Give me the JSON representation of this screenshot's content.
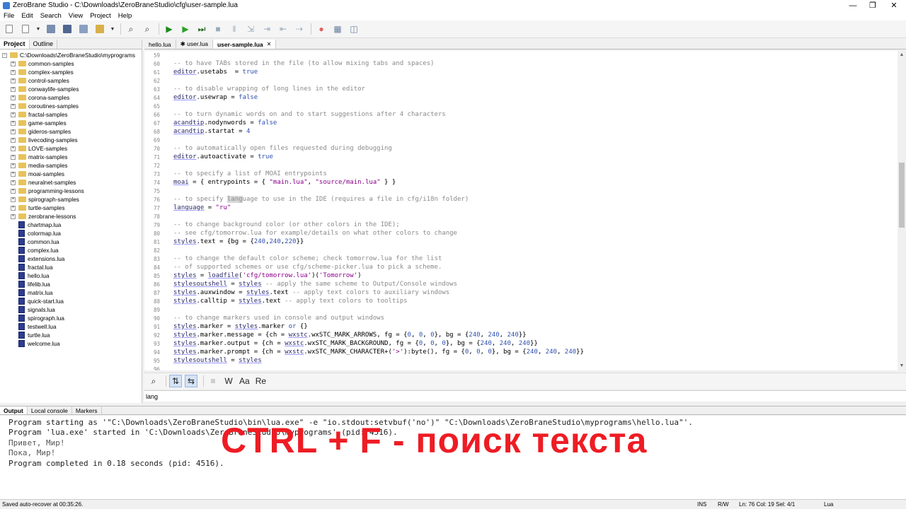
{
  "window": {
    "title": "ZeroBrane Studio - C:\\Downloads\\ZeroBraneStudio\\cfg\\user-sample.lua",
    "controls": [
      "—",
      "❐",
      "✕"
    ]
  },
  "menu": [
    "File",
    "Edit",
    "Search",
    "View",
    "Project",
    "Help"
  ],
  "toolbar": {
    "icons": [
      "new-file-icon",
      "open-file-icon",
      "dropdown-icon",
      "save-icon",
      "save-all-icon",
      "project-dir-icon",
      "project-dropdown-icon",
      "find-icon",
      "replace-icon",
      "start-debug-icon",
      "run-icon",
      "run-now-icon",
      "stop-icon",
      "break-icon",
      "step-into-icon",
      "step-over-icon",
      "step-out-icon",
      "run-to-cursor-icon",
      "toggle-breakpoint-icon",
      "stack-window-icon",
      "watch-window-icon"
    ]
  },
  "left_pane": {
    "tabs": [
      "Project",
      "Outline"
    ],
    "root": "C:\\Downloads\\ZeroBraneStudio\\myprograms",
    "folders": [
      "common-samples",
      "complex-samples",
      "control-samples",
      "conwaylife-samples",
      "corona-samples",
      "coroutines-samples",
      "fractal-samples",
      "game-samples",
      "gideros-samples",
      "livecoding-samples",
      "LOVE-samples",
      "matrix-samples",
      "media-samples",
      "moai-samples",
      "neuralnet-samples",
      "programming-lessons",
      "spirograph-samples",
      "turtle-samples",
      "zerobrane-lessons"
    ],
    "files": [
      "chartmap.lua",
      "colormap.lua",
      "common.lua",
      "complex.lua",
      "extensions.lua",
      "fractal.lua",
      "hello.lua",
      "lifelib.lua",
      "matrix.lua",
      "quick-start.lua",
      "signals.lua",
      "spirograph.lua",
      "testwell.lua",
      "turtle.lua",
      "welcome.lua"
    ]
  },
  "editor": {
    "tabs": [
      {
        "label": "hello.lua"
      },
      {
        "label": "✱ user.lua"
      },
      {
        "label": "user-sample.lua",
        "close": "✕"
      }
    ],
    "lines": [
      {
        "n": "59",
        "html": ""
      },
      {
        "n": "60",
        "html": "<span class='cm'>-- to have TABs stored in the file (to allow mixing tabs and spaces)</span>"
      },
      {
        "n": "61",
        "html": "<span class='idf'>editor</span>.usetabs  = <span class='kw'>true</span>"
      },
      {
        "n": "62",
        "html": ""
      },
      {
        "n": "63",
        "html": "<span class='cm'>-- to disable wrapping of long lines in the editor</span>"
      },
      {
        "n": "64",
        "html": "<span class='idf'>editor</span>.usewrap = <span class='kw'>false</span>"
      },
      {
        "n": "65",
        "html": ""
      },
      {
        "n": "66",
        "html": "<span class='cm'>-- to turn dynamic words on and to start suggestions after 4 characters</span>"
      },
      {
        "n": "67",
        "html": "<span class='idf'>acandtip</span>.nodynwords = <span class='kw'>false</span>"
      },
      {
        "n": "68",
        "html": "<span class='idf'>acandtip</span>.startat = <span class='num'>4</span>"
      },
      {
        "n": "69",
        "html": ""
      },
      {
        "n": "70",
        "html": "<span class='cm'>-- to automatically open files requested during debugging</span>"
      },
      {
        "n": "71",
        "html": "<span class='idf'>editor</span>.autoactivate = <span class='kw'>true</span>"
      },
      {
        "n": "72",
        "html": ""
      },
      {
        "n": "73",
        "html": "<span class='cm'>-- to specify a list of MOAI entrypoints</span>"
      },
      {
        "n": "74",
        "html": "<span class='idf'>moai</span> = { entrypoints = { <span class='str'>\"main.lua\"</span>, <span class='str'>\"source/main.lua\"</span> } }"
      },
      {
        "n": "75",
        "html": ""
      },
      {
        "n": "76",
        "html": "<span class='cm'>-- to specify <span class='hl'>lang</span>uage to use in the IDE (requires a file in cfg/i18n folder)</span>"
      },
      {
        "n": "77",
        "html": "<span class='idf'>language</span> = <span class='str'>\"ru\"</span>"
      },
      {
        "n": "78",
        "html": ""
      },
      {
        "n": "79",
        "html": "<span class='cm'>-- to change background color (or other colors in the IDE);</span>"
      },
      {
        "n": "80",
        "html": "<span class='cm'>-- see cfg/tomorrow.lua for example/details on what other colors to change</span>"
      },
      {
        "n": "81",
        "html": "<span class='idf'>styles</span>.text = {bg = {<span class='num'>240</span>,<span class='num'>240</span>,<span class='num'>220</span>}}"
      },
      {
        "n": "82",
        "html": ""
      },
      {
        "n": "83",
        "html": "<span class='cm'>-- to change the default color scheme; check tomorrow.lua for the list</span>"
      },
      {
        "n": "84",
        "html": "<span class='cm'>-- of supported schemes or use cfg/scheme-picker.lua to pick a scheme.</span>"
      },
      {
        "n": "85",
        "html": "<span class='idf'>styles</span> = <span class='idf'>loadfile</span>(<span class='str'>'cfg/tomorrow.lua'</span>)(<span class='str'>'Tomorrow'</span>)"
      },
      {
        "n": "86",
        "html": "<span class='idf'>stylesoutshell</span> = <span class='idf'>styles</span> <span class='cm'>-- apply the same scheme to Output/Console windows</span>"
      },
      {
        "n": "87",
        "html": "<span class='idf'>styles</span>.auxwindow = <span class='idf'>styles</span>.text <span class='cm'>-- apply text colors to auxiliary windows</span>"
      },
      {
        "n": "88",
        "html": "<span class='idf'>styles</span>.calltip = <span class='idf'>styles</span>.text <span class='cm'>-- apply text colors to tooltips</span>"
      },
      {
        "n": "89",
        "html": ""
      },
      {
        "n": "90",
        "html": "<span class='cm'>-- to change markers used in console and output windows</span>"
      },
      {
        "n": "91",
        "html": "<span class='idf'>styles</span>.marker = <span class='idf'>styles</span>.marker <span class='kw'>or</span> {}"
      },
      {
        "n": "92",
        "html": "<span class='idf'>styles</span>.marker.message = {ch = <span class='idf'>wxstc</span>.wxSTC_MARK_ARROWS, fg = {<span class='num'>0</span>, <span class='num'>0</span>, <span class='num'>0</span>}, bg = {<span class='num'>240</span>, <span class='num'>240</span>, <span class='num'>240</span>}}"
      },
      {
        "n": "93",
        "html": "<span class='idf'>styles</span>.marker.output = {ch = <span class='idf'>wxstc</span>.wxSTC_MARK_BACKGROUND, fg = {<span class='num'>0</span>, <span class='num'>0</span>, <span class='num'>0</span>}, bg = {<span class='num'>240</span>, <span class='num'>240</span>, <span class='num'>240</span>}}"
      },
      {
        "n": "94",
        "html": "<span class='idf'>styles</span>.marker.prompt = {ch = <span class='idf'>wxstc</span>.wxSTC_MARK_CHARACTER+(<span class='str'>'>'</span>):byte(), fg = {<span class='num'>0</span>, <span class='num'>0</span>, <span class='num'>0</span>}, bg = {<span class='num'>240</span>, <span class='num'>240</span>, <span class='num'>240</span>}}"
      },
      {
        "n": "95",
        "html": "<span class='idf'>stylesoutshell</span> = <span class='idf'>styles</span>"
      },
      {
        "n": "96",
        "html": ""
      }
    ]
  },
  "findbar": {
    "buttons": [
      "find-icon",
      "in-selection-icon",
      "wrap-around-icon",
      "context-icon",
      "W",
      "Aa",
      "Re"
    ],
    "value": "lang"
  },
  "output": {
    "tabs": [
      "Output",
      "Local console",
      "Markers"
    ],
    "lines": [
      "Program starting as '\"C:\\Downloads\\ZeroBraneStudio\\bin\\lua.exe\" -e \"io.stdout:setvbuf('no')\" \"C:\\Downloads\\ZeroBraneStudio\\myprograms\\hello.lua\"'.",
      "Program 'lua.exe' started in 'C:\\Downloads\\ZeroBraneStudio\\myprograms' (pid: 4516).",
      "Привет, Мир!",
      "Пока, Мир!",
      "Program completed in 0.18 seconds (pid: 4516)."
    ],
    "overlay": "CTRL + F - поиск текста"
  },
  "status": {
    "message": "Saved auto-recover at 00:35:26.",
    "ins": "INS",
    "rw": "R/W",
    "position": "Ln: 76 Col: 19 Sel: 4/1",
    "language": "Lua"
  }
}
